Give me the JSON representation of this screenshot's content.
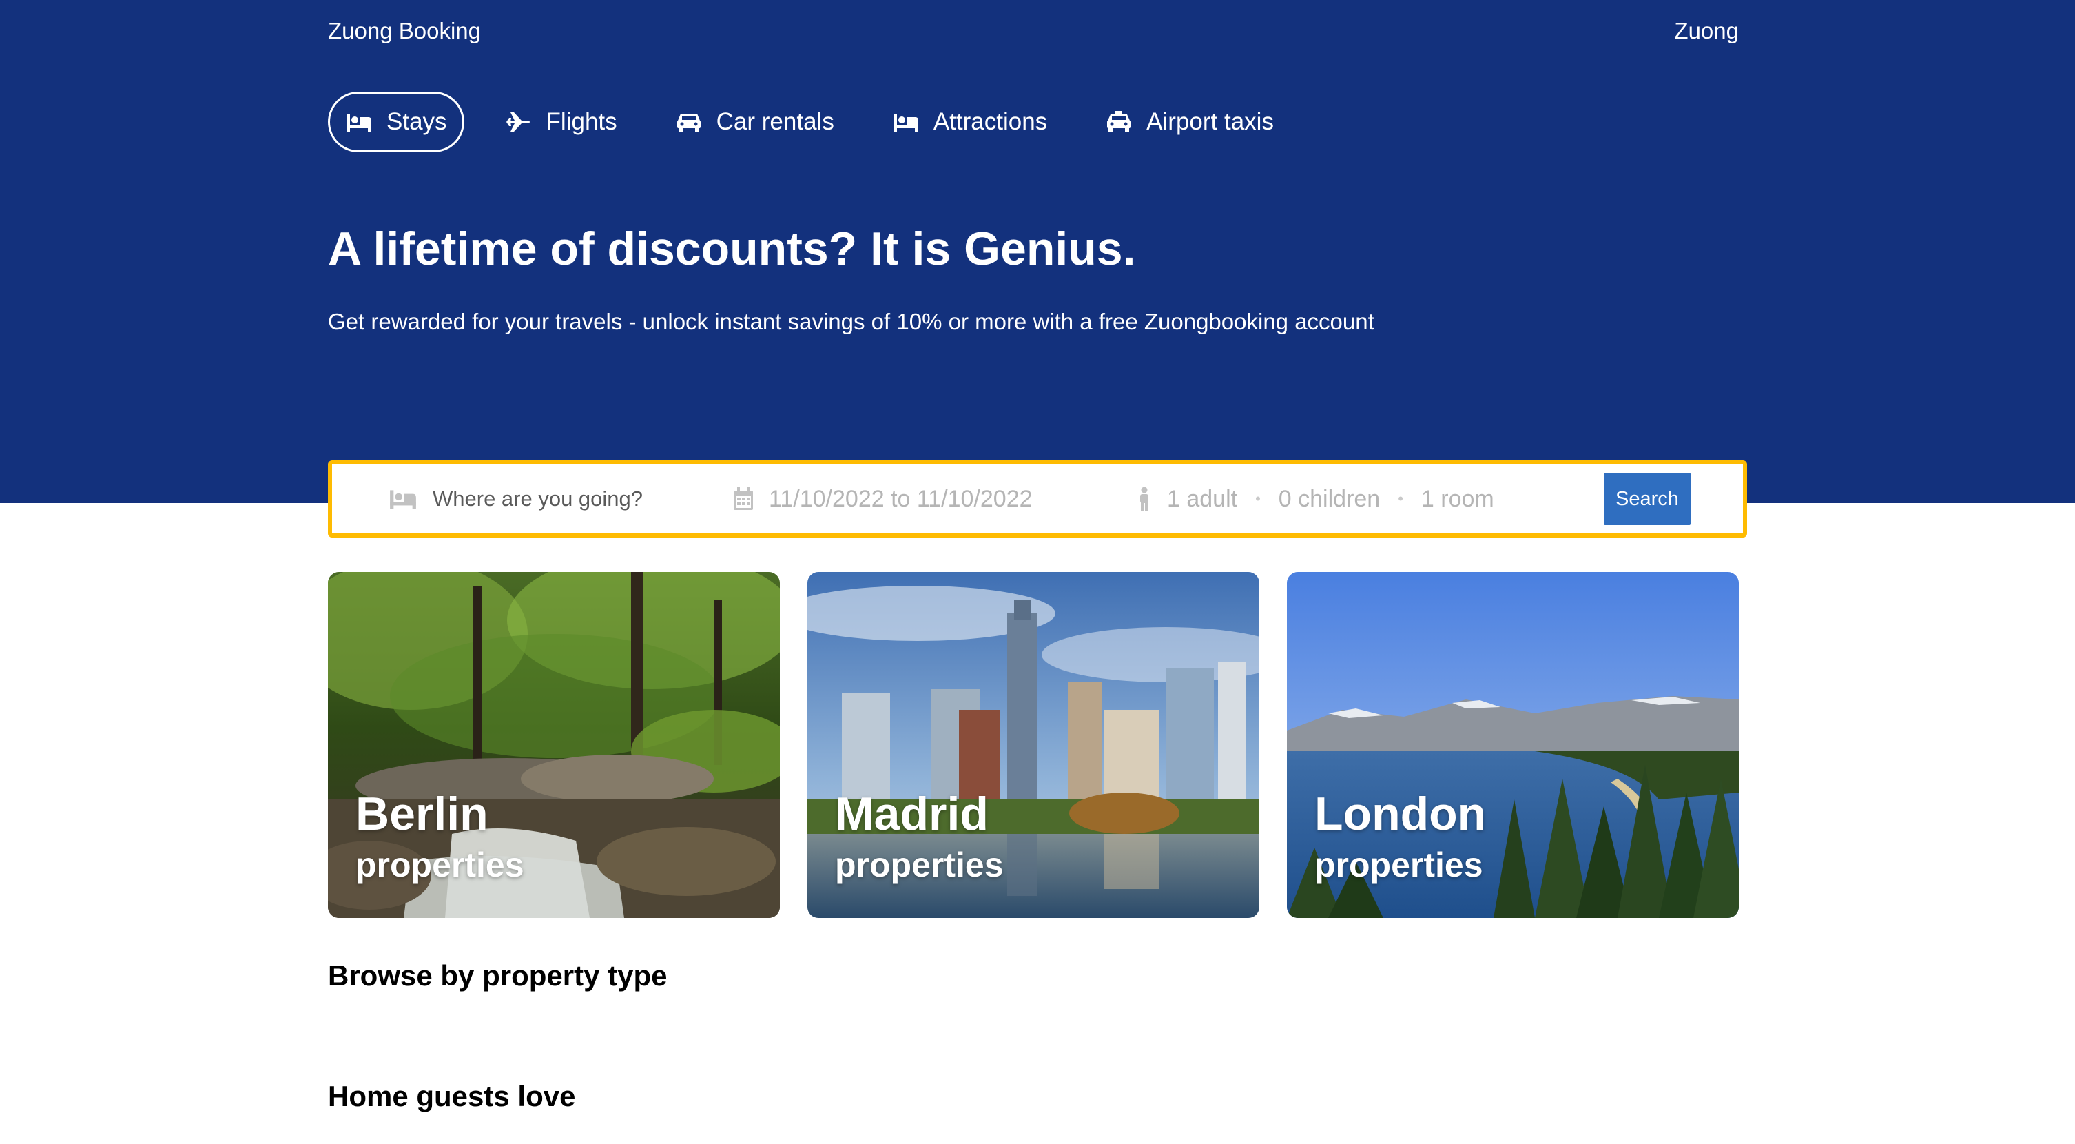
{
  "brand": "Zuong Booking",
  "user": "Zuong",
  "nav": [
    {
      "label": "Stays",
      "icon": "bed-icon",
      "active": true
    },
    {
      "label": "Flights",
      "icon": "plane-icon",
      "active": false
    },
    {
      "label": "Car rentals",
      "icon": "car-icon",
      "active": false
    },
    {
      "label": "Attractions",
      "icon": "bed-icon",
      "active": false
    },
    {
      "label": "Airport taxis",
      "icon": "taxi-icon",
      "active": false
    }
  ],
  "hero": {
    "title": "A lifetime of discounts? It is Genius.",
    "subtitle": "Get rewarded for your travels - unlock instant savings of 10% or more with a free Zuongbooking account"
  },
  "search": {
    "destination_placeholder": "Where are you going?",
    "dates": "11/10/2022 to 11/10/2022",
    "adults": "1 adult",
    "children": "0 children",
    "rooms": "1 room",
    "separator": "•",
    "button": "Search"
  },
  "featured": [
    {
      "city": "Berlin",
      "subtitle": "properties"
    },
    {
      "city": "Madrid",
      "subtitle": "properties"
    },
    {
      "city": "London",
      "subtitle": "properties"
    }
  ],
  "sections": {
    "property_type": "Browse by property type",
    "guests_love": "Home guests love"
  },
  "colors": {
    "header_bg": "#13317d",
    "search_border": "#febb02",
    "search_button": "#2f6ec0"
  }
}
